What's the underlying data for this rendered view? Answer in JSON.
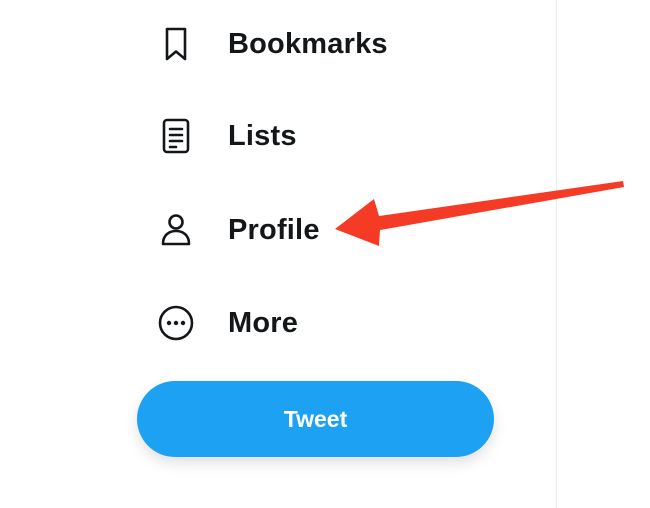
{
  "nav": {
    "items": [
      {
        "id": "bookmarks",
        "label": "Bookmarks",
        "icon": "bookmark-icon"
      },
      {
        "id": "lists",
        "label": "Lists",
        "icon": "list-icon"
      },
      {
        "id": "profile",
        "label": "Profile",
        "icon": "profile-icon"
      },
      {
        "id": "more",
        "label": "More",
        "icon": "more-icon"
      }
    ]
  },
  "tweet_button": {
    "label": "Tweet"
  },
  "colors": {
    "accent": "#1da1f2",
    "text": "#14171a",
    "annotation": "#f53a25",
    "divider": "#e6ecf0"
  }
}
